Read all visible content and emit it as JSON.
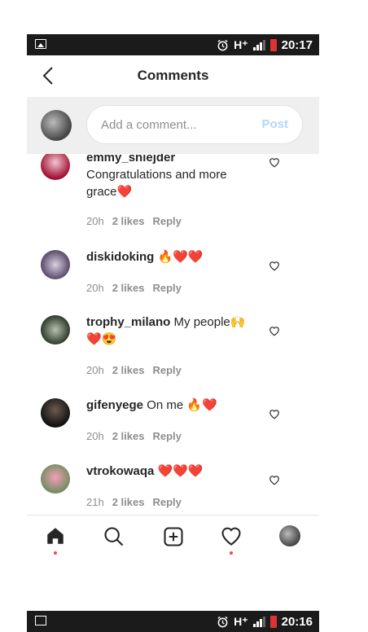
{
  "status_bar": {
    "time": "20:17",
    "network": "H⁺"
  },
  "status_bar_bottom": {
    "time": "20:16",
    "network": "H⁺"
  },
  "header": {
    "title": "Comments"
  },
  "composer": {
    "placeholder": "Add a comment...",
    "post_label": "Post"
  },
  "comments": [
    {
      "username": "emmy_sniejder",
      "text": "Congratulations and more grace",
      "emoji": "❤️",
      "time": "20h",
      "likes": "2 likes",
      "reply": "Reply"
    },
    {
      "username": "diskidoking",
      "text": "",
      "emoji": "🔥❤️❤️",
      "time": "20h",
      "likes": "2 likes",
      "reply": "Reply"
    },
    {
      "username": "trophy_milano",
      "text": "My people",
      "emoji": "🙌❤️😍",
      "time": "20h",
      "likes": "2 likes",
      "reply": "Reply"
    },
    {
      "username": "gifenyege",
      "text": "On me",
      "emoji": "🔥❤️",
      "time": "20h",
      "likes": "2 likes",
      "reply": "Reply"
    },
    {
      "username": "vtrokowaqa",
      "text": "",
      "emoji": "❤️❤️❤️",
      "time": "21h",
      "likes": "2 likes",
      "reply": "Reply"
    }
  ],
  "nav": {
    "icons": [
      "home-icon",
      "search-icon",
      "add-post-icon",
      "activity-heart-icon",
      "profile-avatar"
    ]
  },
  "colors": {
    "accent_disabled": "#b3d6f7",
    "notification_dot": "#ed4956",
    "heart_red": "#e0212f"
  }
}
